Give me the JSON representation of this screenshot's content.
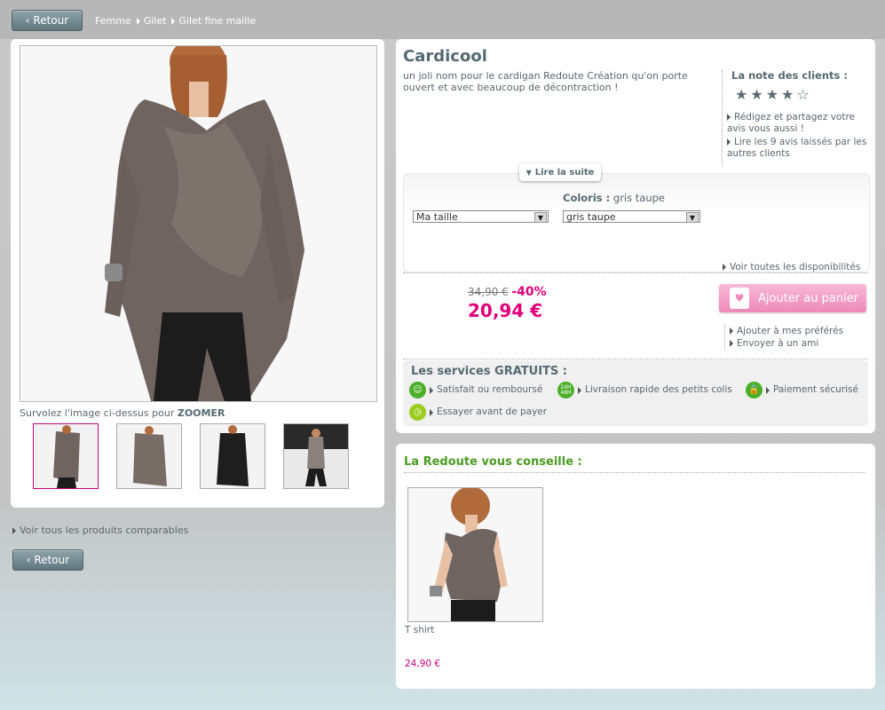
{
  "header": {
    "back_label": "‹ Retour",
    "breadcrumb": [
      "Femme",
      "Gilet",
      "Gilet fine maille"
    ]
  },
  "gallery": {
    "zoom_prefix": "Survolez l'image ci-dessus pour ",
    "zoom_word": "ZOOMER"
  },
  "product": {
    "title": "Cardicool",
    "description": "un joli nom pour le cardigan Redoute Création qu'on porte ouvert et avec beaucoup de décontraction !",
    "read_more": "Lire la suite",
    "rating": {
      "title": "La note des clients :",
      "stars": 4,
      "max": 5,
      "link_write": "Rédigez et partagez votre avis vous aussi !",
      "link_read": "Lire les 9 avis laissés par les autres clients"
    },
    "options": {
      "color_label": "Coloris :",
      "color_value": "gris taupe",
      "size_select": "Ma taille",
      "color_select": "gris taupe"
    },
    "availability_link": "Voir toutes les disponibilités",
    "old_price": "34,90 €",
    "discount": "-40%",
    "price": "20,94 €",
    "add_to_cart": "Ajouter au panier",
    "add_favorites": "Ajouter à mes préférés",
    "send_friend": "Envoyer à un ami"
  },
  "services": {
    "title": "Les services GRATUITS :",
    "items": [
      {
        "icon": "smiley-icon",
        "label": "Satisfait ou remboursé"
      },
      {
        "icon": "24h-48h-icon",
        "label": "Livraison rapide des petits colis"
      },
      {
        "icon": "lock-icon",
        "label": "Paiement sécurisé"
      },
      {
        "icon": "clock-icon",
        "label": "Essayer avant de payer"
      }
    ]
  },
  "advice": {
    "title": "La Redoute vous conseille :",
    "product_name": "T shirt",
    "product_price": "24,90 €"
  },
  "footer": {
    "comparable_link": "Voir tous les produits comparables",
    "back_label": "‹ Retour"
  },
  "colors": {
    "accent_pink": "#e2007a",
    "green": "#4a9b22",
    "slate": "#556a72"
  }
}
